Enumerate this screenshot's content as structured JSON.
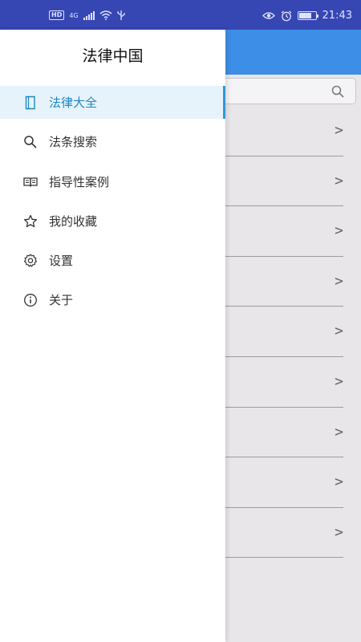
{
  "status_bar": {
    "network_badge": "HD",
    "network_type": "4G",
    "time": "21:43",
    "battery_level": 0.75
  },
  "drawer": {
    "title": "法律中国",
    "items": [
      {
        "label": "法律大全",
        "icon": "book-icon",
        "active": true
      },
      {
        "label": "法条搜索",
        "icon": "search-icon",
        "active": false
      },
      {
        "label": "指导性案例",
        "icon": "open-book-icon",
        "active": false
      },
      {
        "label": "我的收藏",
        "icon": "star-icon",
        "active": false
      },
      {
        "label": "设置",
        "icon": "gear-icon",
        "active": false
      },
      {
        "label": "关于",
        "icon": "info-icon",
        "active": false
      }
    ]
  },
  "background_list": {
    "chevron": ">",
    "row_count": 9
  },
  "colors": {
    "status_bar": "#3646b3",
    "app_bar": "#3d8ee6",
    "active_item_bg": "#e6f3fb",
    "active_accent": "#2e9ad2"
  }
}
